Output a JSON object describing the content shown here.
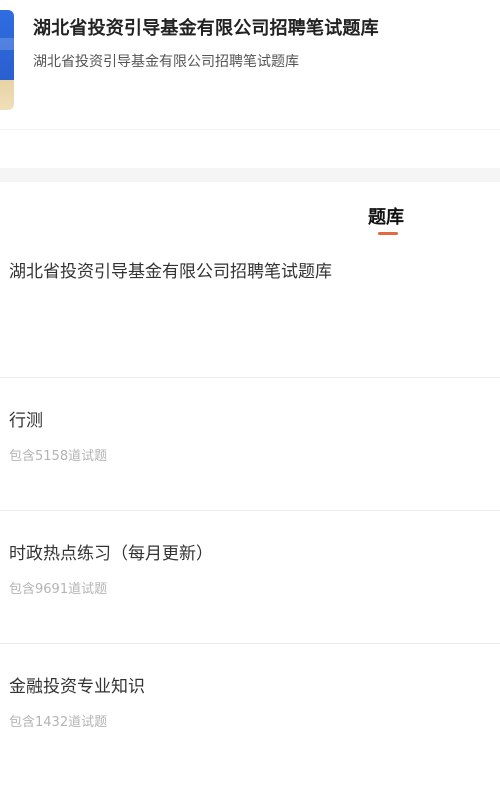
{
  "header": {
    "title": "湖北省投资引导基金有限公司招聘笔试题库",
    "subtitle": "湖北省投资引导基金有限公司招聘笔试题库",
    "cover_icon": "book-cover-icon"
  },
  "tabs": [
    {
      "label": "题库",
      "active": true
    }
  ],
  "colors": {
    "accent": "#e06b42",
    "cover_blue": "#2f6de0"
  },
  "bank": {
    "name": "湖北省投资引导基金有限公司招聘笔试题库"
  },
  "items": [
    {
      "title": "行测",
      "count": "包含5158道试题"
    },
    {
      "title": "时政热点练习（每月更新）",
      "count": "包含9691道试题"
    },
    {
      "title": "金融投资专业知识",
      "count": "包含1432道试题"
    }
  ]
}
